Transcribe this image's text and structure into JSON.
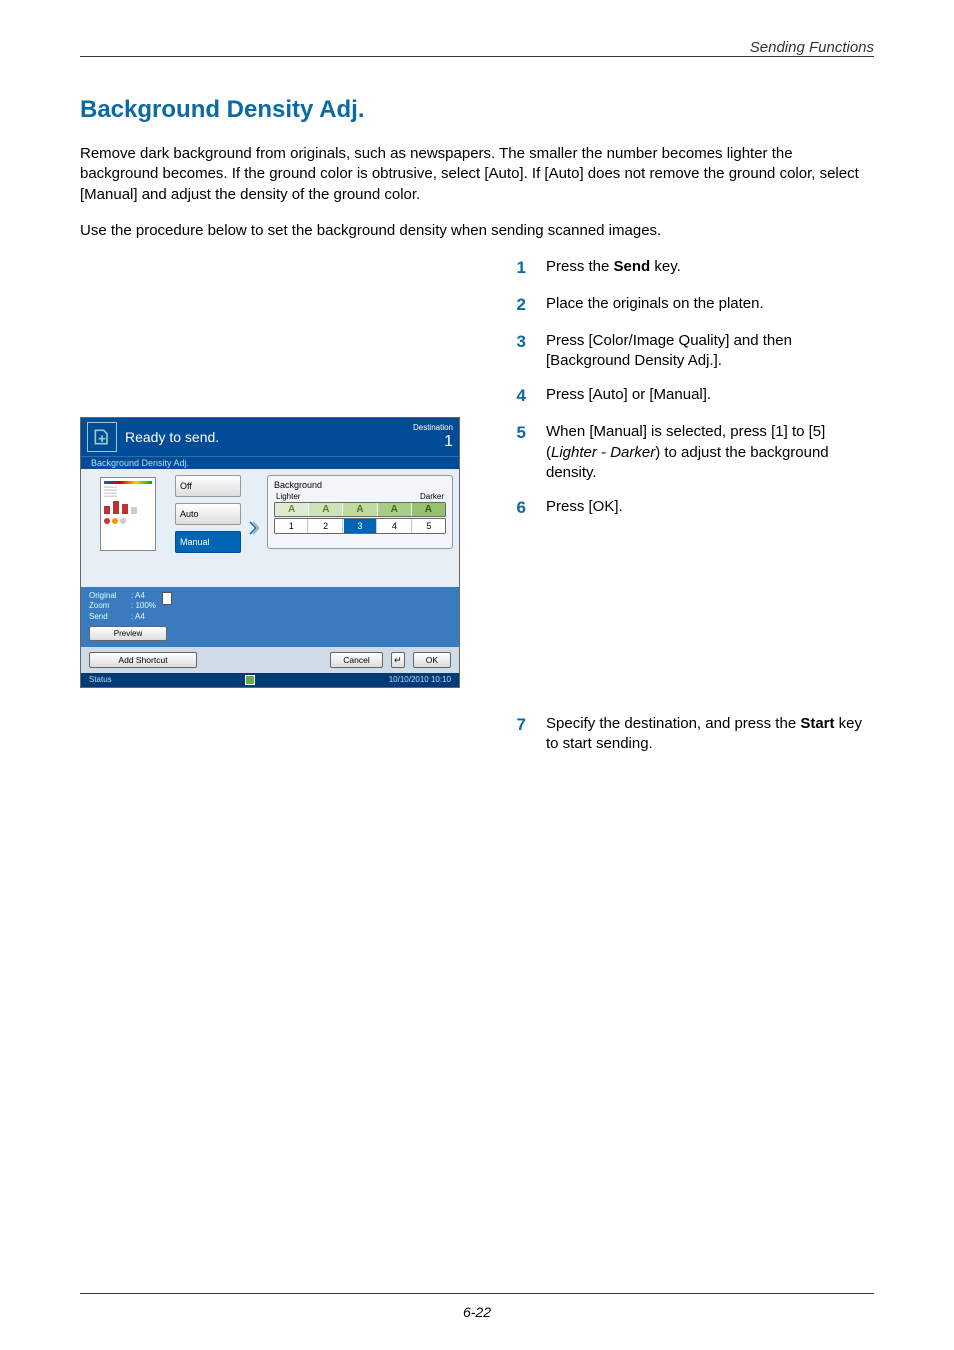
{
  "running_head": "Sending Functions",
  "title": "Background Density Adj.",
  "para1": "Remove dark background from originals, such as newspapers. The smaller the number becomes lighter the background becomes. If the ground color is obtrusive, select [Auto]. If [Auto] does not remove the ground color, select [Manual] and adjust the density of the ground color.",
  "para2": "Use the procedure below to set the background density when sending scanned images.",
  "steps": {
    "s1_pre": "Press the ",
    "s1_bold": "Send",
    "s1_post": " key.",
    "s2": "Place the originals on the platen.",
    "s3": "Press [Color/Image Quality] and then [Background Density Adj.].",
    "s4": "Press [Auto] or [Manual].",
    "s5_pre": "When [Manual] is selected, press [1] to [5] (",
    "s5_it": "Lighter - Darker",
    "s5_post": ") to adjust the background density.",
    "s6": "Press [OK].",
    "s7_pre": "Specify the destination, and press the ",
    "s7_bold": "Start",
    "s7_post": " key to start sending."
  },
  "panel": {
    "ready": "Ready to send.",
    "dest_label": "Destination",
    "dest_count": "1",
    "crumb": "Background Density Adj.",
    "modes": {
      "off": "Off",
      "auto": "Auto",
      "manual": "Manual"
    },
    "density": {
      "box_label": "Background",
      "lighter": "Lighter",
      "darker": "Darker",
      "levels": [
        "1",
        "2",
        "3",
        "4",
        "5"
      ],
      "selected": "3"
    },
    "info": {
      "original_lbl": "Original",
      "original_val": ": A4",
      "zoom_lbl": "Zoom",
      "zoom_val": ": 100%",
      "send_lbl": "Send",
      "send_val": ": A4"
    },
    "preview_btn": "Preview",
    "add_shortcut": "Add Shortcut",
    "cancel": "Cancel",
    "ok": "OK",
    "status": "Status",
    "timestamp": "10/10/2010   10:10"
  },
  "page_number": "6-22"
}
